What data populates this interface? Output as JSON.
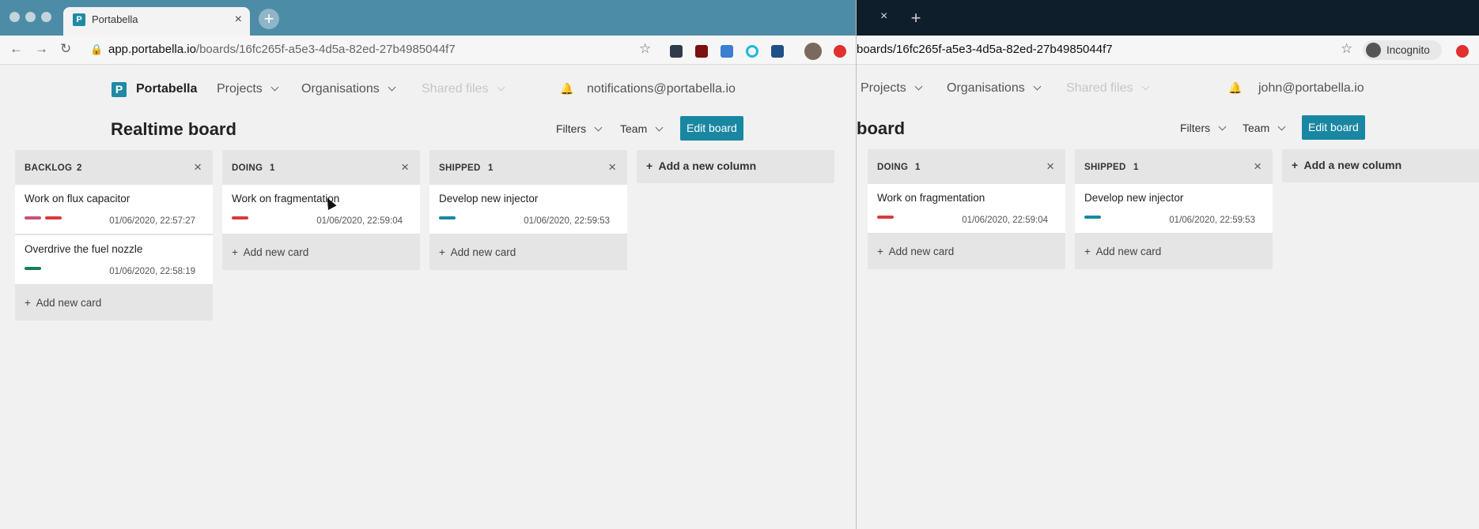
{
  "left_window": {
    "tab_title": "Portabella",
    "tab_favicon": "P",
    "url": {
      "host": "app.portabella.io",
      "path": "/boards/16fc265f-a5e3-4d5a-82ed-27b4985044f7"
    },
    "nav": {
      "brand": "Portabella",
      "brand_mark": "P",
      "projects": "Projects",
      "organisations": "Organisations",
      "shared_files": "Shared files",
      "user": "notifications@portabella.io"
    },
    "board": {
      "title": "Realtime board",
      "filters": "Filters",
      "team": "Team",
      "edit": "Edit board"
    },
    "columns": [
      {
        "title": "BACKLOG",
        "count": "2",
        "cards": [
          {
            "title": "Work on flux capacitor",
            "time": "01/06/2020, 22:57:27",
            "tags": [
              "#c8527a",
              "#d93b3b"
            ]
          },
          {
            "title": "Overdrive the fuel nozzle",
            "time": "01/06/2020, 22:58:19",
            "tags": [
              "#1b7a5a"
            ]
          }
        ]
      },
      {
        "title": "DOING",
        "count": "1",
        "cards": [
          {
            "title": "Work on fragmentation",
            "time": "01/06/2020, 22:59:04",
            "tags": [
              "#d93b3b"
            ]
          }
        ]
      },
      {
        "title": "SHIPPED",
        "count": "1",
        "cards": [
          {
            "title": "Develop new injector",
            "time": "01/06/2020, 22:59:53",
            "tags": [
              "#1a87a2"
            ]
          }
        ]
      }
    ],
    "add_card": "Add new card",
    "add_column": "Add a new column"
  },
  "right_window": {
    "url": {
      "path": "boards/16fc265f-a5e3-4d5a-82ed-27b4985044f7"
    },
    "incognito": "Incognito",
    "nav": {
      "projects": "Projects",
      "organisations": "Organisations",
      "shared_files": "Shared files",
      "user": "john@portabella.io"
    },
    "board": {
      "title_partial": "board",
      "filters": "Filters",
      "team": "Team",
      "edit": "Edit board"
    },
    "columns": [
      {
        "title": "DOING",
        "count": "1",
        "cards": [
          {
            "title": "Work on fragmentation",
            "time": "01/06/2020, 22:59:04",
            "tags": [
              "#d93b3b"
            ]
          }
        ]
      },
      {
        "title": "SHIPPED",
        "count": "1",
        "cards": [
          {
            "title": "Develop new injector",
            "time": "01/06/2020, 22:59:53",
            "tags": [
              "#1a87a2"
            ]
          }
        ]
      }
    ],
    "add_card": "Add new card",
    "add_column": "Add a new column"
  },
  "icons": {
    "plus": "+",
    "close": "×"
  }
}
